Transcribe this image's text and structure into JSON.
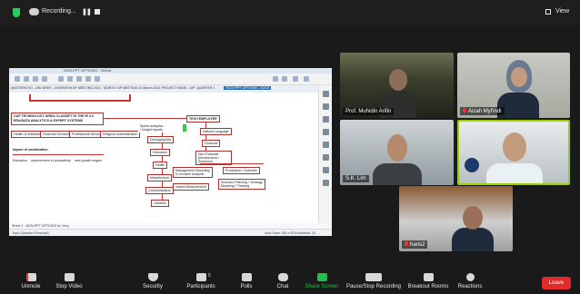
{
  "topbar": {
    "recording_label": "Recording...",
    "pause_label": "❚❚",
    "view_label": "View"
  },
  "shared_screen": {
    "window_title": "NON-PPT OPTIONS - XMind",
    "tabs": [
      "MASTERS RO - UNI WEEK - OVERVIEW",
      "AP MEETING 2021",
      "MONTLY AP MEETING 10 March 2021 PROJECT RANK - UIP",
      "QUARTER 1",
      "TECH PPT OPTIONS - DOCS"
    ],
    "root_left": "CAP TECHNOLOGY AREA/ CLASSIFY IN THE IR 4.0 ERA/DATA ANALYTICS & EXPERT SYSTEMS",
    "root_right": "TECH EMPLOYEE",
    "left_branches": [
      "Health of Arbitration",
      "Financial Services",
      "Professional Service",
      "Religious Administration"
    ],
    "left_sub_heading": "Impact of socialization",
    "left_sub": [
      "Education",
      "improvement in productivity",
      "new growth engine"
    ],
    "center_node": "Speed analytics / Insight reports",
    "center_children": [
      "Demographics",
      "Education",
      "Health",
      "Infrastructure",
      "Communication",
      "Libraries"
    ],
    "right_top": "Natural Language",
    "right_financial": "Financial",
    "right_non_financial": "Non-Financial (Benchmarks / Solutions)",
    "right_left_col": [
      "Management Reporting & Decision Analysis",
      "Impact Measurement"
    ],
    "right_right_col": [
      "Production / Outcome",
      "Scenario Planning / Strategy Modeling / Thinking"
    ],
    "footer_left": "Sheet 1 - NON-PPT OPTIONS for Jerry",
    "status_left": "Topic (Speaker Financial)",
    "status_right": "Auto Save: ON   ≡   62% Modified: 20"
  },
  "participants": [
    {
      "name": "Prof. Muhidin Arifin",
      "muted": false
    },
    {
      "name": "Aizah Myl'indi",
      "muted": true
    },
    {
      "name": "S.K. Lim",
      "muted": false
    },
    {
      "name": "",
      "muted": false
    },
    {
      "name": "haris2",
      "muted": true
    }
  ],
  "toolbar": {
    "items": [
      {
        "label": "Unmute",
        "icon": "microphone-muted-icon"
      },
      {
        "label": "Stop Video",
        "icon": "video-camera-icon"
      },
      {
        "label": "Security",
        "icon": "shield-icon"
      },
      {
        "label": "Participants",
        "icon": "people-icon",
        "count": "5"
      },
      {
        "label": "Polls",
        "icon": "bar-chart-icon"
      },
      {
        "label": "Chat",
        "icon": "chat-bubble-icon"
      },
      {
        "label": "Share Screen",
        "icon": "share-screen-icon"
      },
      {
        "label": "Pause/Stop Recording",
        "icon": "pause-stop-icon"
      },
      {
        "label": "Breakout Rooms",
        "icon": "breakout-rooms-icon"
      },
      {
        "label": "Reactions",
        "icon": "emoji-icon"
      }
    ],
    "leave_label": "Leave"
  },
  "colors": {
    "accent_green": "#1fc04b",
    "active_speaker_border": "#9ed000",
    "leave_red": "#e02b2b"
  }
}
